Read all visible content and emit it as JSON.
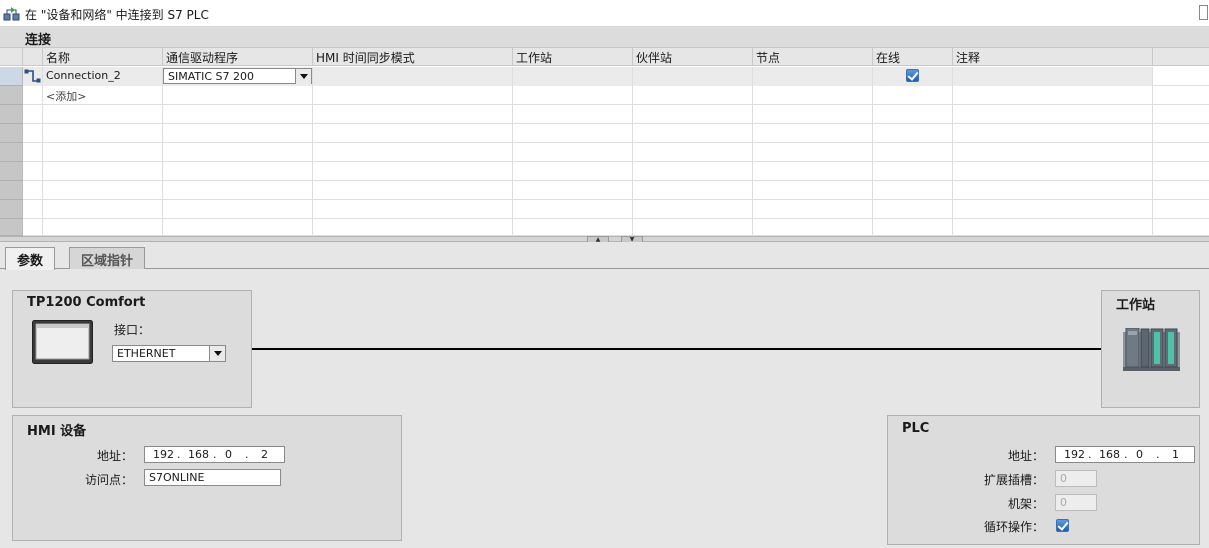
{
  "window": {
    "title": "在 \"设备和网络\" 中连接到 S7 PLC"
  },
  "section": {
    "title": "连接"
  },
  "grid": {
    "columns": [
      "名称",
      "通信驱动程序",
      "HMI 时间同步模式",
      "工作站",
      "伙伴站",
      "节点",
      "在线",
      "注释"
    ],
    "rows": [
      {
        "name": "Connection_2",
        "driver": "SIMATIC S7 200",
        "hmi_sync": "",
        "station": "",
        "partner": "",
        "node": "",
        "online": true,
        "comment": ""
      }
    ],
    "add_label": "<添加>"
  },
  "tabs": [
    {
      "label": "参数",
      "active": true
    },
    {
      "label": "区域指针",
      "active": false
    }
  ],
  "device_panel": {
    "title": "TP1200 Comfort",
    "interface_label": "接口：",
    "interface_value": "ETHERNET"
  },
  "station_panel": {
    "title": "工作站"
  },
  "hmi_panel": {
    "title": "HMI 设备",
    "address_label": "地址：",
    "address": [
      "192",
      "168",
      "0",
      "2"
    ],
    "access_point_label": "访问点：",
    "access_point": "S7ONLINE"
  },
  "plc_panel": {
    "title": "PLC",
    "address_label": "地址：",
    "address": [
      "192",
      "168",
      "0",
      "1"
    ],
    "slot_label": "扩展插槽：",
    "slot": "0",
    "rack_label": "机架：",
    "rack": "0",
    "cyclic_label": "循环操作：",
    "cyclic": true
  },
  "colors": {
    "checkbox": "#2f6fc0",
    "connection_line": "#000000",
    "selected_gutter": "#ccd8e6"
  },
  "icons": {
    "title": "network-connection-icon",
    "row": "connection-icon",
    "hmi": "hmi-panel-icon",
    "station": "plc-station-icon"
  }
}
